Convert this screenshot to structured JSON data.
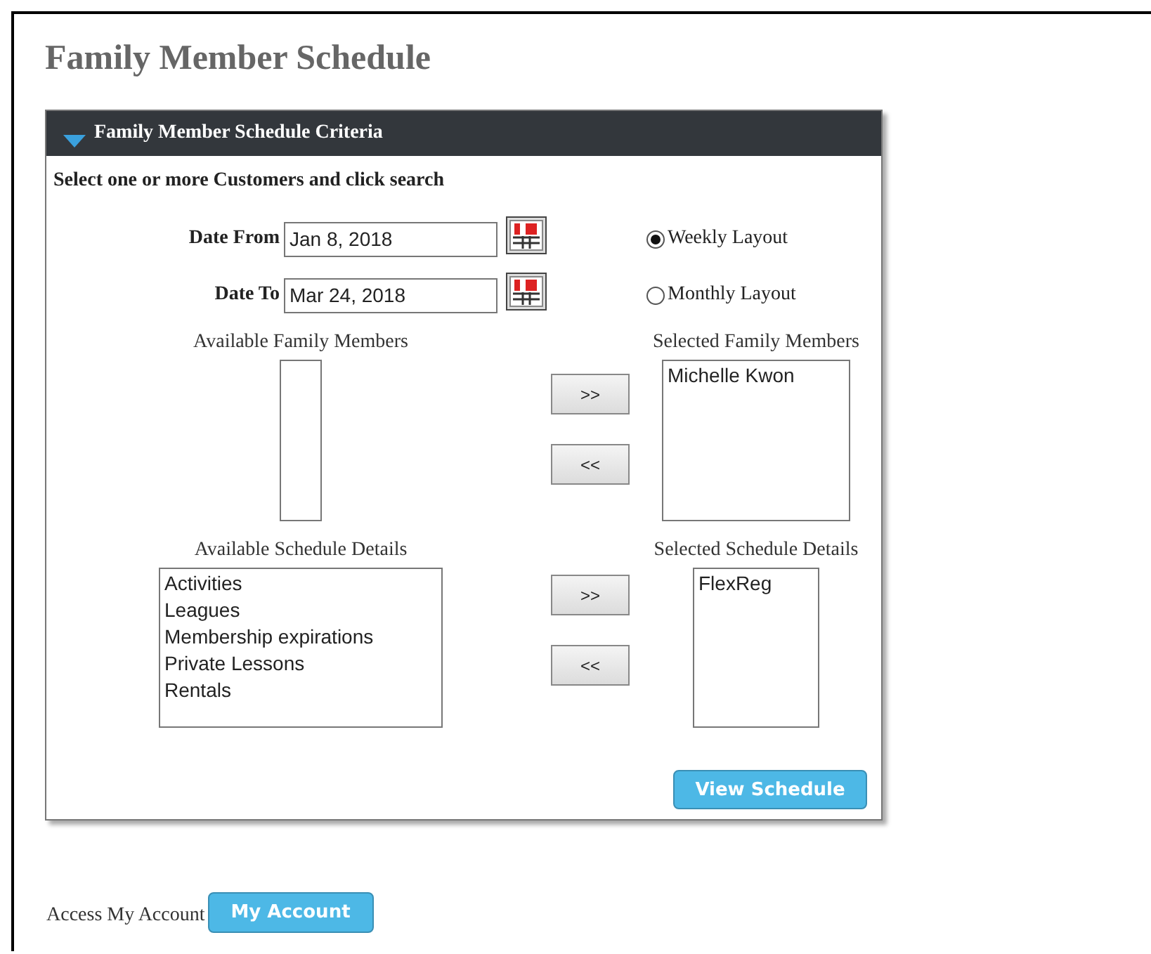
{
  "page": {
    "title": "Family Member Schedule"
  },
  "criteria": {
    "header": "Family Member Schedule Criteria",
    "expanded": true,
    "instruction": "Select one or more Customers and click search",
    "date_from": {
      "label": "Date From",
      "value": "Jan 8, 2018"
    },
    "date_to": {
      "label": "Date To",
      "value": "Mar 24, 2018"
    },
    "layouts": [
      {
        "label": "Weekly Layout",
        "selected": true
      },
      {
        "label": "Monthly Layout",
        "selected": false
      }
    ],
    "pickers": [
      {
        "available_label": "Available Family Members",
        "selected_label": "Selected Family Members",
        "chosen": [
          {
            "text": "Michelle Kwon",
            "selected": false
          }
        ],
        "add": ">>",
        "remove": "<<"
      },
      {
        "available_label": "Available Schedule Details",
        "available": [
          {
            "text": "Activities",
            "selected": false
          },
          {
            "text": "Leagues",
            "selected": false
          },
          {
            "text": "Membership expirations",
            "selected": false
          },
          {
            "text": "Private Lessons",
            "selected": false
          },
          {
            "text": "Rentals",
            "selected": false
          }
        ],
        "selected_label": "Selected Schedule Details",
        "chosen": [
          {
            "text": "FlexReg",
            "selected": false
          }
        ],
        "add": ">>",
        "remove": "<<"
      }
    ],
    "submit": "View Schedule"
  },
  "account": {
    "text": "Access My Account",
    "button": "My Account"
  }
}
